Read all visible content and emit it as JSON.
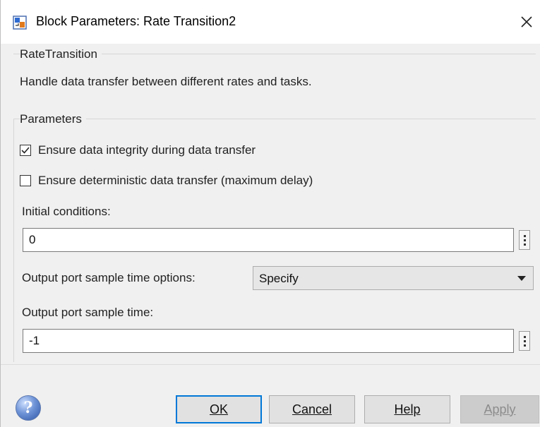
{
  "window": {
    "title": "Block Parameters: Rate Transition2",
    "close_glyph": "✕"
  },
  "block": {
    "type_label": "RateTransition",
    "description": "Handle data transfer between different rates and tasks."
  },
  "parameters": {
    "label": "Parameters",
    "checkboxes": [
      {
        "label": "Ensure data integrity during data transfer",
        "checked": true
      },
      {
        "label": "Ensure deterministic data transfer (maximum delay)",
        "checked": false
      }
    ],
    "initial_conditions": {
      "label": "Initial conditions:",
      "value": "0"
    },
    "sample_time_options": {
      "label": "Output port sample time options:",
      "selected": "Specify"
    },
    "sample_time": {
      "label": "Output port sample time:",
      "value": "-1"
    }
  },
  "buttons": {
    "ok": "OK",
    "cancel": "Cancel",
    "help": "Help",
    "apply": "Apply",
    "help_icon": "?"
  },
  "colors": {
    "default_button_border": "#0078d7",
    "window_background": "#f0f0f0"
  }
}
